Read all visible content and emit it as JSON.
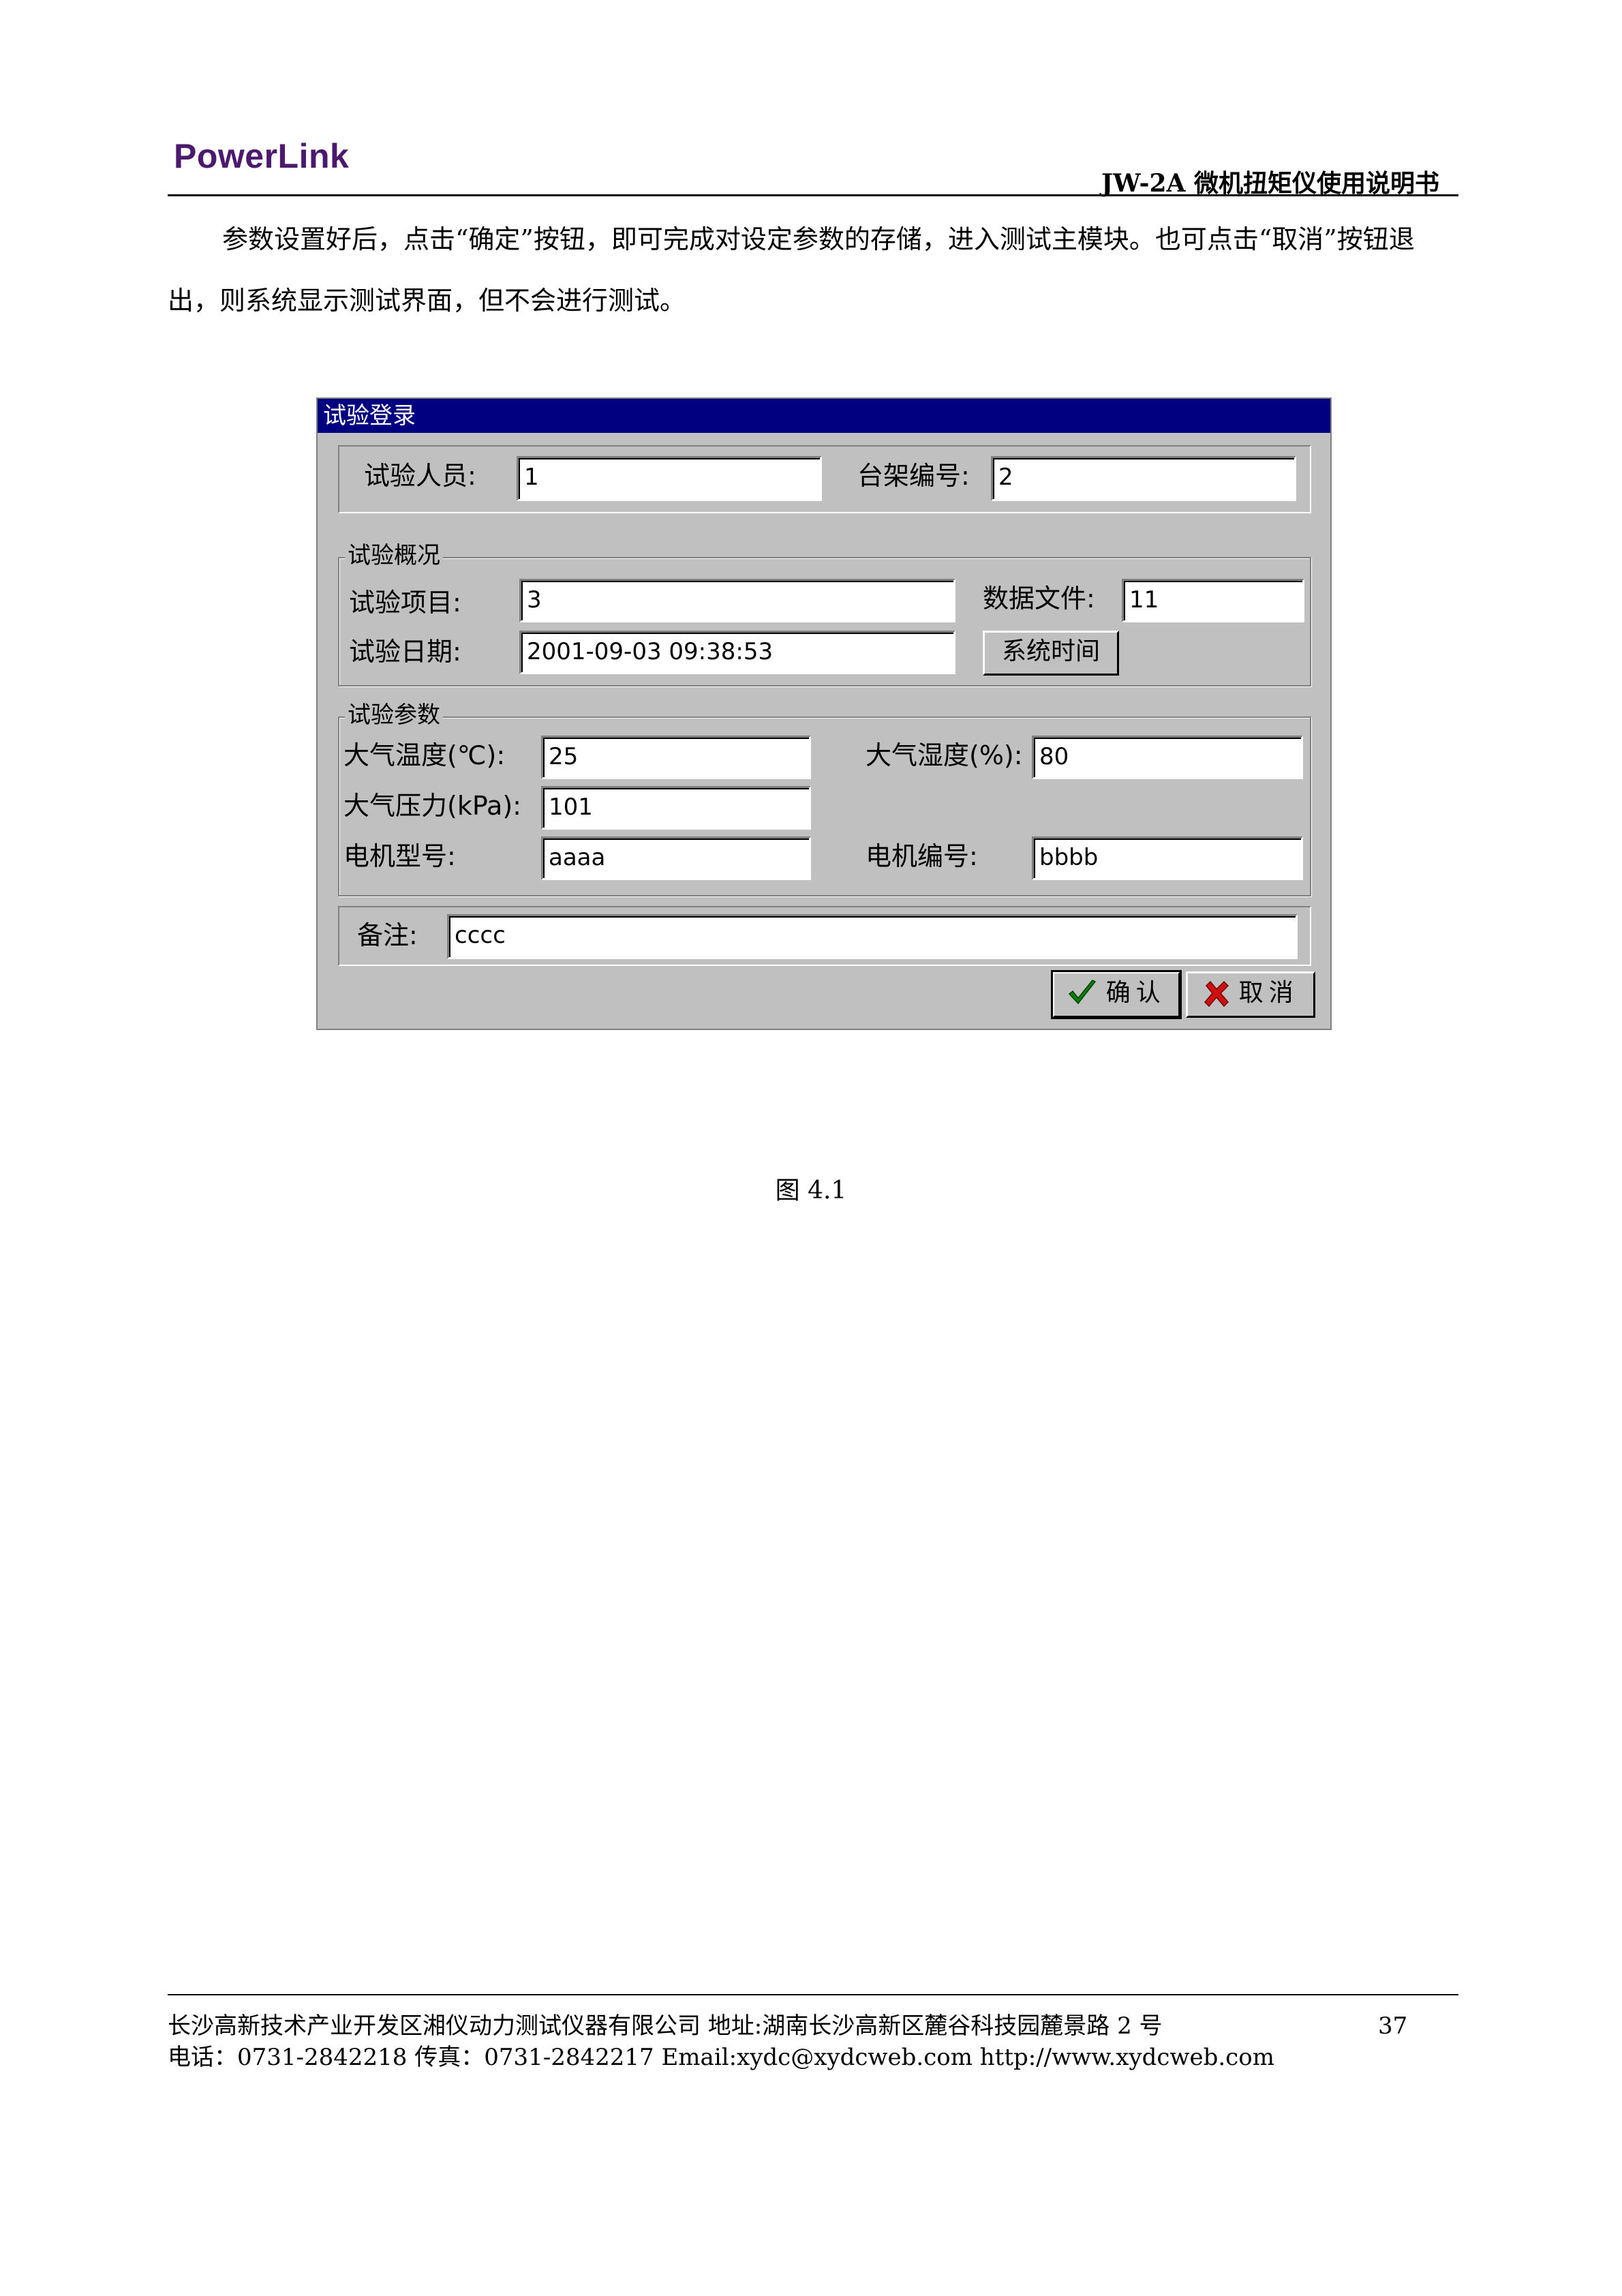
{
  "header": {
    "logo": "PowerLink",
    "doc_title": "JW-2A 微机扭矩仪使用说明书"
  },
  "paragraph": "参数设置好后，点击“确定”按钮，即可完成对设定参数的存储，进入测试主模块。也可点击“取消”按钮退出，则系统显示测试界面，但不会进行测试。",
  "dialog": {
    "title": "试验登录",
    "top": {
      "operator_label": "试验人员:",
      "operator_value": "1",
      "bench_label": "台架编号:",
      "bench_value": "2"
    },
    "overview": {
      "legend": "试验概况",
      "item_label": "试验项目:",
      "item_value": "3",
      "datafile_label": "数据文件:",
      "datafile_value": "11",
      "date_label": "试验日期:",
      "date_value": "2001-09-03 09:38:53",
      "system_time_button": "系统时间"
    },
    "params": {
      "legend": "试验参数",
      "temp_label": "大气温度(℃):",
      "temp_value": "25",
      "humidity_label": "大气湿度(%):",
      "humidity_value": "80",
      "pressure_label": "大气压力(kPa):",
      "pressure_value": "101",
      "motor_model_label": "电机型号:",
      "motor_model_value": "aaaa",
      "motor_no_label": "电机编号:",
      "motor_no_value": "bbbb"
    },
    "remark_label": "备注:",
    "remark_value": "cccc",
    "ok_button": "确认",
    "cancel_button": "取消",
    "ok_icon": "check-icon",
    "cancel_icon": "cross-icon"
  },
  "caption": "图 4.1",
  "footer": {
    "line1": "长沙高新技术产业开发区湘仪动力测试仪器有限公司 地址:湖南长沙高新区麓谷科技园麓景路 2 号",
    "line2": "电话：0731-2842218      传真：0731-2842217     Email:xydc@xydcweb.com     http://www.xydcweb.com",
    "page_number": "37"
  }
}
